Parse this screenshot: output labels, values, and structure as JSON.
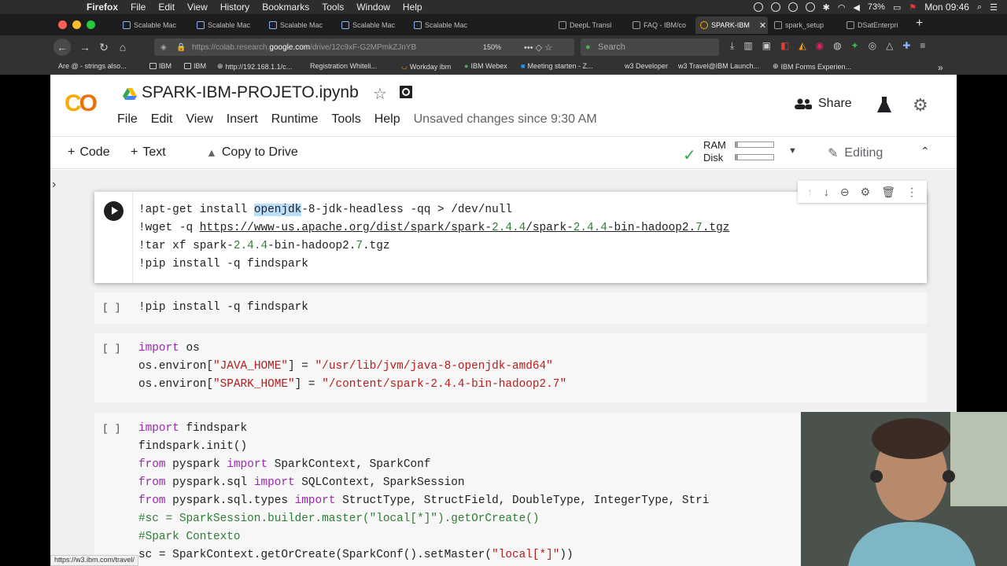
{
  "menubar": {
    "app": "Firefox",
    "items": [
      "File",
      "Edit",
      "View",
      "History",
      "Bookmarks",
      "Tools",
      "Window",
      "Help"
    ],
    "battery": "73%",
    "clock": "Mon 09:46"
  },
  "tabs": [
    {
      "label": "Scalable Mac"
    },
    {
      "label": "Scalable Mac"
    },
    {
      "label": "Scalable Mac"
    },
    {
      "label": "Scalable Mac"
    },
    {
      "label": "Scalable Mac"
    },
    {
      "label": "DeepL Transl"
    },
    {
      "label": "FAQ - IBM/co"
    },
    {
      "label": "SPARK-IBM"
    },
    {
      "label": "spark_setup"
    },
    {
      "label": "DSatEnterpri"
    }
  ],
  "navbar": {
    "url_prefix": "https://colab.research.",
    "url_domain": "google.com",
    "url_rest": "/drive/12c9xF-G2MPmkZJnYB",
    "zoom": "150%",
    "search_placeholder": "Search"
  },
  "bookmarks": [
    "Are @ - strings also...",
    "IBM",
    "IBM",
    "http://192.168.1.1/c...",
    "Registration Whiteli...",
    "Workday ibm",
    "IBM Webex",
    "Meeting starten - Z...",
    "w3 Developer",
    "w3 Travel@IBM Launch...",
    "IBM Forms Experien..."
  ],
  "colab": {
    "title": "SPARK-IBM-PROJETO.ipynb",
    "menu": [
      "File",
      "Edit",
      "View",
      "Insert",
      "Runtime",
      "Tools",
      "Help"
    ],
    "unsaved": "Unsaved changes since 9:30 AM",
    "share": "Share",
    "toolbar": {
      "code": "Code",
      "text": "Text",
      "copy_to_drive": "Copy to Drive",
      "ram": "RAM",
      "disk": "Disk",
      "editing": "Editing"
    },
    "ram_usage": 0.06,
    "disk_usage": 0.06
  },
  "cells": {
    "c1": {
      "l1a": "!apt-get install ",
      "l1sel": "openjdk",
      "l1b": "-8-jdk-headless -qq > /dev/null",
      "l2a": "!wget -q ",
      "l2url": "https://www-us.apache.org/dist/spark/spark-",
      "l2n1": "2.4.4",
      "l2url2": "/spark-",
      "l2n2": "2.4.4",
      "l2url3": "-bin-hadoop2.",
      "l2n3": "7",
      "l2url4": ".tgz",
      "l3a": "!tar xf spark-",
      "l3n1": "2.4.4",
      "l3b": "-bin-hadoop2.",
      "l3n2": "7",
      "l3c": ".tgz",
      "l4": "!pip install -q findspark"
    },
    "c2": {
      "gutter": "[ ]",
      "l1": "!pip install -q findspark"
    },
    "c3": {
      "gutter": "[ ]",
      "kw_import": "import",
      "os": " os",
      "l2a": "os.environ[",
      "l2s1": "\"JAVA_HOME\"",
      "l2b": "] = ",
      "l2s2": "\"/usr/lib/jvm/java-8-openjdk-amd64\"",
      "l3a": "os.environ[",
      "l3s1": "\"SPARK_HOME\"",
      "l3b": "] = ",
      "l3s2": "\"/content/spark-2.4.4-bin-hadoop2.7\""
    },
    "c4": {
      "gutter": "[ ]",
      "l1kw": "import",
      "l1b": " findspark",
      "l2": "findspark.init()",
      "l3kw1": "from",
      "l3b": " pyspark ",
      "l3kw2": "import",
      "l3c": " SparkContext, SparkConf",
      "l4kw1": "from",
      "l4b": " pyspark.sql ",
      "l4kw2": "import",
      "l4c": " SQLContext, SparkSession",
      "l5kw1": "from",
      "l5b": " pyspark.sql.types ",
      "l5kw2": "import",
      "l5c": " StructType, StructField, DoubleType, IntegerType, Stri",
      "l6": "#sc = SparkSession.builder.master(\"local[*]\").getOrCreate()",
      "l7": "#Spark Contexto",
      "l8a": "sc = SparkContext.getOrCreate(SparkConf().setMaster(",
      "l8s": "\"local[*]\"",
      "l8b": "))"
    }
  },
  "status_url": "https://w3.ibm.com/travel/"
}
